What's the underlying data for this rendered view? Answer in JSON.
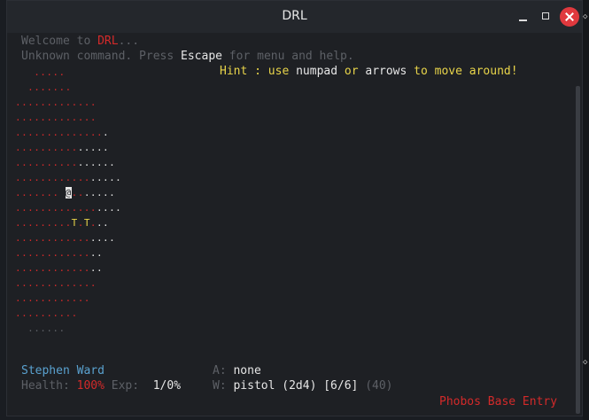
{
  "window": {
    "title": "DRL"
  },
  "messages": {
    "welcome_prefix": "Welcome to ",
    "welcome_game": "DRL",
    "welcome_suffix": "...",
    "unknown_prefix": "Unknown command. Press ",
    "unknown_key": "Escape",
    "unknown_suffix": " for menu and help.",
    "hint_a": "Hint : use ",
    "hint_b": "numpad",
    "hint_c": " or ",
    "hint_d": "arrows",
    "hint_e": " to move around!"
  },
  "map_rows": [
    {
      "red": "   .....",
      "white": ""
    },
    {
      "red": "  .......",
      "white": ""
    },
    {
      "red": ".............",
      "white": ""
    },
    {
      "red": ".............",
      "white": ""
    },
    {
      "red": "..............",
      "white": "."
    },
    {
      "red": "..........",
      "white": "....."
    },
    {
      "red": "..........",
      "white": "......"
    },
    {
      "red": "............",
      "white": "....."
    },
    {
      "red": "....... ",
      "player": "@",
      "red2": "..",
      "white": "....."
    },
    {
      "red": ".............",
      "white": "...."
    },
    {
      "red": ".........",
      "item1": "T",
      "red2": ".",
      "item2": "T",
      "red3": ".",
      "white": ".."
    },
    {
      "red": "............",
      "white": "...."
    },
    {
      "red": "............",
      "white": ".."
    },
    {
      "red": "............",
      "white": ".."
    },
    {
      "red": ".............",
      "white": ""
    },
    {
      "red": "............",
      "white": ""
    },
    {
      "red": "..........",
      "white": ""
    },
    {
      "red": "",
      "white": "",
      "gray": "  ......"
    }
  ],
  "status": {
    "player_name": "Stephen Ward",
    "health_label": "Health: ",
    "health_value": "100%",
    "exp_label": " Exp: ",
    "exp_value": " 1/0%",
    "armor_label": "A: ",
    "armor_value": "none",
    "weapon_label": "W: ",
    "weapon_value": "pistol (2d4) [6/6]",
    "weapon_extra": " (40)",
    "location": "Phobos Base Entry"
  },
  "colors": {
    "red": "#d42a2a",
    "yellow": "#e8d44a",
    "blue": "#5aa2d0",
    "close_button": "#e0393e"
  }
}
